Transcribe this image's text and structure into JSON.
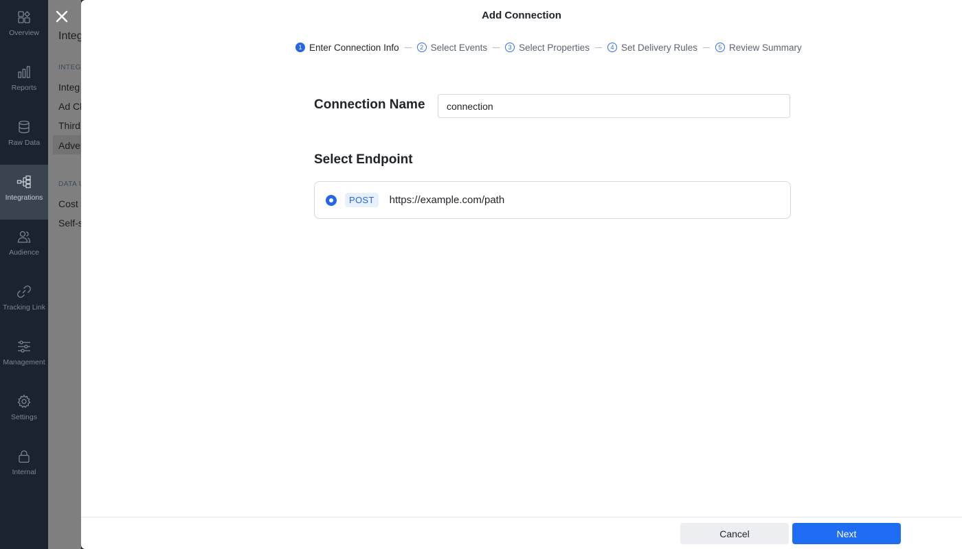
{
  "rail": {
    "items": [
      {
        "label": "Overview",
        "icon": "overview-icon"
      },
      {
        "label": "Reports",
        "icon": "bar-chart-icon"
      },
      {
        "label": "Raw Data",
        "icon": "database-icon"
      },
      {
        "label": "Integrations",
        "icon": "integrations-icon",
        "active": true
      },
      {
        "label": "Audience",
        "icon": "users-icon"
      },
      {
        "label": "Tracking Link",
        "icon": "link-icon"
      },
      {
        "label": "Management",
        "icon": "sliders-icon"
      },
      {
        "label": "Settings",
        "icon": "gear-icon"
      },
      {
        "label": "Internal",
        "icon": "lock-icon"
      }
    ]
  },
  "subpanel": {
    "title": "Integ",
    "section1": "INTEG",
    "items1": [
      "Integ",
      "Ad Cl",
      "Third",
      "Adve"
    ],
    "section2": "DATA U",
    "items2": [
      "Cost",
      "Self-s"
    ]
  },
  "modal": {
    "title": "Add Connection",
    "steps": [
      {
        "num": "1",
        "label": "Enter Connection Info",
        "active": true
      },
      {
        "num": "2",
        "label": "Select Events"
      },
      {
        "num": "3",
        "label": "Select Properties"
      },
      {
        "num": "4",
        "label": "Set Delivery Rules"
      },
      {
        "num": "5",
        "label": "Review Summary"
      }
    ],
    "connection_name_label": "Connection Name",
    "connection_name_value": "connection",
    "select_endpoint_label": "Select Endpoint",
    "endpoint": {
      "method": "POST",
      "url": "https://example.com/path",
      "selected": true
    },
    "cancel_label": "Cancel",
    "next_label": "Next"
  },
  "colors": {
    "accent": "#1f6df2",
    "rail_bg": "#1b2330",
    "rail_active": "#3a4350"
  }
}
